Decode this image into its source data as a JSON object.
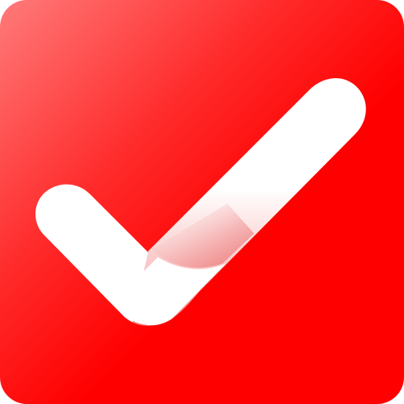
{
  "icon": {
    "name": "checkmark-icon",
    "colors": {
      "background_light": "#ff6b6b",
      "background_mid": "#ff2020",
      "background_dark": "#ff0000",
      "check_fill": "#ffffff",
      "fold_shadow": "#f7b3b3"
    }
  }
}
